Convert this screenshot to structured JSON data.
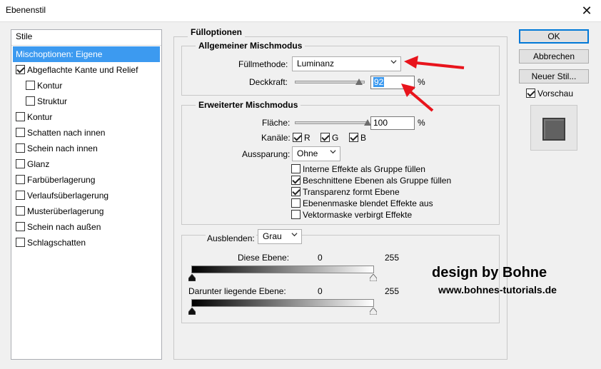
{
  "window": {
    "title": "Ebenenstil",
    "close_glyph": "✕"
  },
  "styles_list": {
    "header": "Stile",
    "items": [
      {
        "label": "Mischoptionen: Eigene",
        "selected": true,
        "checkbox": false,
        "checked": false,
        "indent": false
      },
      {
        "label": "Abgeflachte Kante und Relief",
        "selected": false,
        "checkbox": true,
        "checked": true,
        "indent": false
      },
      {
        "label": "Kontur",
        "selected": false,
        "checkbox": true,
        "checked": false,
        "indent": true
      },
      {
        "label": "Struktur",
        "selected": false,
        "checkbox": true,
        "checked": false,
        "indent": true
      },
      {
        "label": "Kontur",
        "selected": false,
        "checkbox": true,
        "checked": false,
        "indent": false
      },
      {
        "label": "Schatten nach innen",
        "selected": false,
        "checkbox": true,
        "checked": false,
        "indent": false
      },
      {
        "label": "Schein nach innen",
        "selected": false,
        "checkbox": true,
        "checked": false,
        "indent": false
      },
      {
        "label": "Glanz",
        "selected": false,
        "checkbox": true,
        "checked": false,
        "indent": false
      },
      {
        "label": "Farbüberlagerung",
        "selected": false,
        "checkbox": true,
        "checked": false,
        "indent": false
      },
      {
        "label": "Verlaufsüberlagerung",
        "selected": false,
        "checkbox": true,
        "checked": false,
        "indent": false
      },
      {
        "label": "Musterüberlagerung",
        "selected": false,
        "checkbox": true,
        "checked": false,
        "indent": false
      },
      {
        "label": "Schein nach außen",
        "selected": false,
        "checkbox": true,
        "checked": false,
        "indent": false
      },
      {
        "label": "Schlagschatten",
        "selected": false,
        "checkbox": true,
        "checked": false,
        "indent": false
      }
    ]
  },
  "fill_options": {
    "title": "Fülloptionen",
    "general": {
      "title": "Allgemeiner Mischmodus",
      "fill_method_label": "Füllmethode:",
      "fill_method_value": "Luminanz",
      "opacity_label": "Deckkraft:",
      "opacity_value": "92",
      "opacity_unit": "%",
      "opacity_level": 0.92
    },
    "advanced": {
      "title": "Erweiterter Mischmodus",
      "fill_label": "Fläche:",
      "fill_value": "100",
      "fill_unit": "%",
      "fill_level": 1.0,
      "channels_label": "Kanäle:",
      "channels": [
        {
          "label": "R",
          "checked": true
        },
        {
          "label": "G",
          "checked": true
        },
        {
          "label": "B",
          "checked": true
        }
      ],
      "knockout_label": "Aussparung:",
      "knockout_value": "Ohne",
      "options": [
        {
          "label": "Interne Effekte als Gruppe füllen",
          "checked": false
        },
        {
          "label": "Beschnittene Ebenen als Gruppe füllen",
          "checked": true
        },
        {
          "label": "Transparenz formt Ebene",
          "checked": true
        },
        {
          "label": "Ebenenmaske blendet Effekte aus",
          "checked": false
        },
        {
          "label": "Vektormaske verbirgt Effekte",
          "checked": false
        }
      ]
    },
    "blend_if": {
      "label": "Ausblenden:",
      "value": "Grau",
      "this_layer_label": "Diese Ebene:",
      "this_layer_min": "0",
      "this_layer_max": "255",
      "underlying_label": "Darunter liegende Ebene:",
      "underlying_min": "0",
      "underlying_max": "255"
    }
  },
  "buttons": {
    "ok": "OK",
    "cancel": "Abbrechen",
    "new_style": "Neuer Stil...",
    "preview_label": "Vorschau",
    "preview_checked": true
  },
  "watermark": {
    "line1": "design by Bohne",
    "line2": "www.bohnes-tutorials.de"
  },
  "colors": {
    "selection": "#3c9af0",
    "arrow": "#e8141c",
    "default_button_border": "#0078d7"
  }
}
